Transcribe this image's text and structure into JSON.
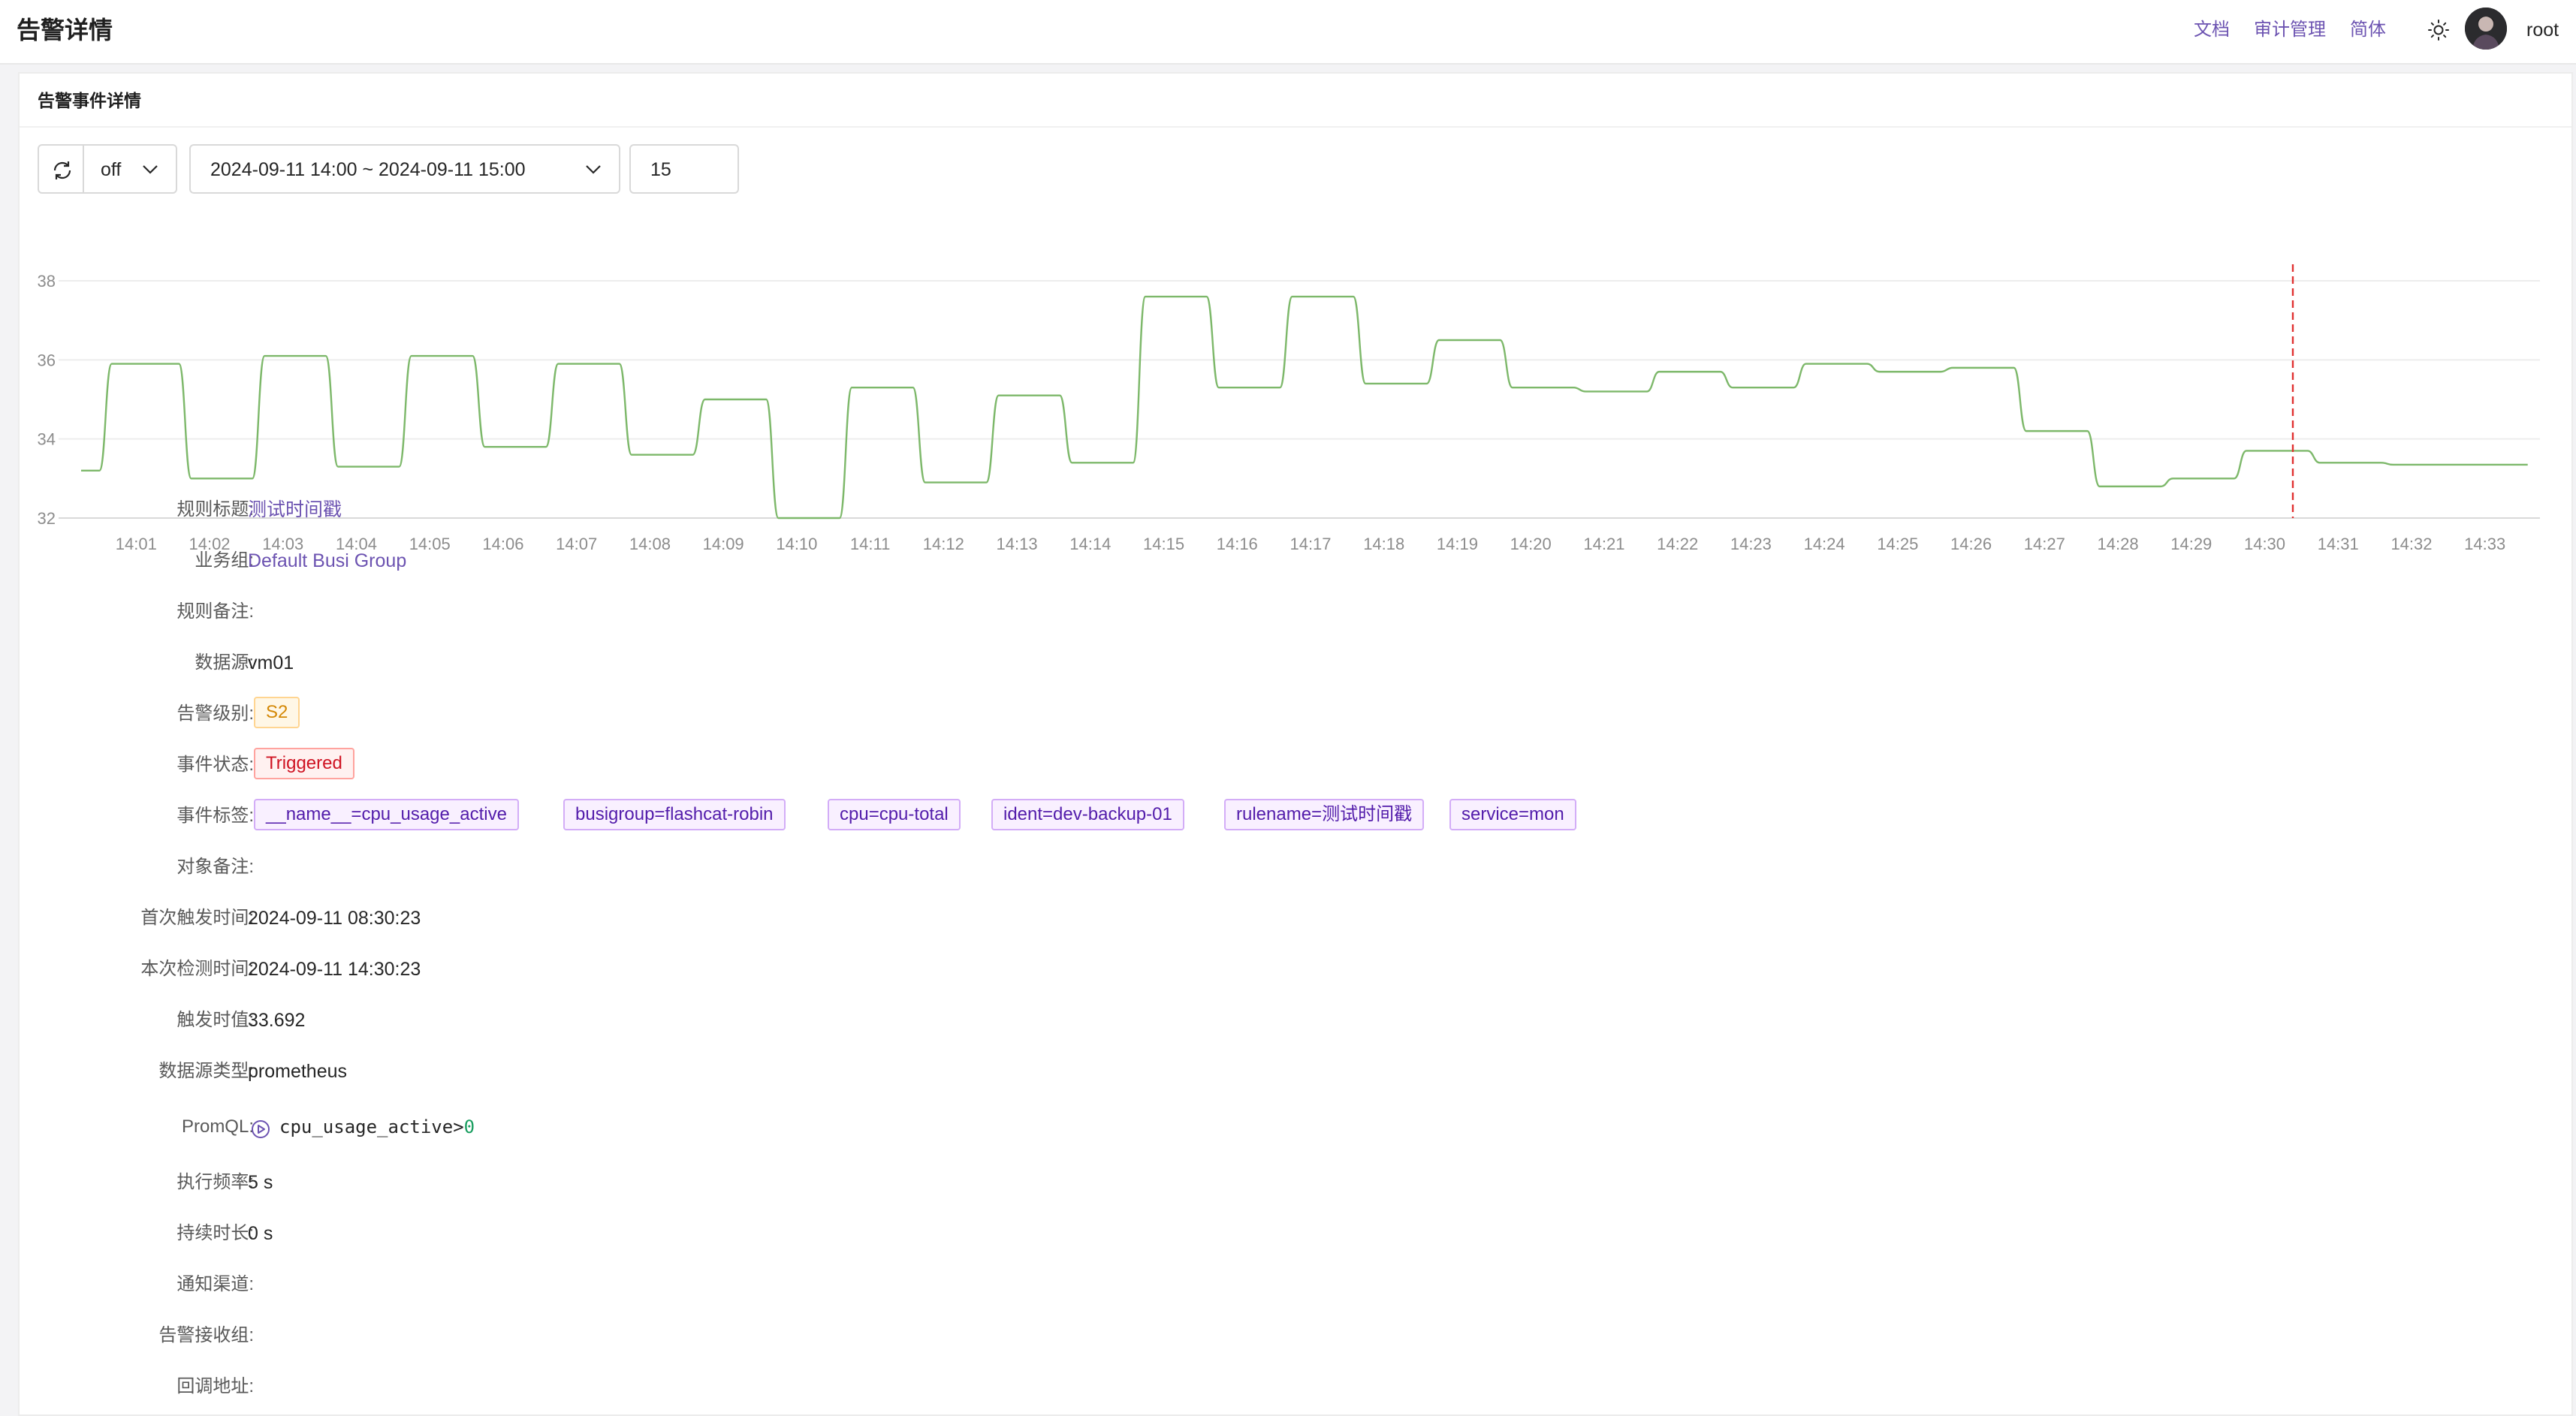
{
  "header": {
    "title": "告警详情",
    "links": [
      "文档",
      "审计管理",
      "简体"
    ],
    "user": "root"
  },
  "card": {
    "title": "告警事件详情",
    "toolbar": {
      "refresh_interval": "off",
      "time_range": "2024-09-11 14:00 ~ 2024-09-11 15:00",
      "step": "15"
    }
  },
  "chart_data": {
    "type": "line",
    "series": [
      {
        "color": "#7db86a",
        "points": [
          [
            "14:00:15",
            33.2
          ],
          [
            "14:00:30",
            33.2
          ],
          [
            "14:00:40",
            35.9
          ],
          [
            "14:01:35",
            35.9
          ],
          [
            "14:01:45",
            33.0
          ],
          [
            "14:02:35",
            33.0
          ],
          [
            "14:02:45",
            36.1
          ],
          [
            "14:03:35",
            36.1
          ],
          [
            "14:03:45",
            33.3
          ],
          [
            "14:04:35",
            33.3
          ],
          [
            "14:04:45",
            36.1
          ],
          [
            "14:05:35",
            36.1
          ],
          [
            "14:05:45",
            33.8
          ],
          [
            "14:06:35",
            33.8
          ],
          [
            "14:06:45",
            35.9
          ],
          [
            "14:07:35",
            35.9
          ],
          [
            "14:07:45",
            33.6
          ],
          [
            "14:08:35",
            33.6
          ],
          [
            "14:08:45",
            35.0
          ],
          [
            "14:09:35",
            35.0
          ],
          [
            "14:09:45",
            32.0
          ],
          [
            "14:10:35",
            32.0
          ],
          [
            "14:10:45",
            35.3
          ],
          [
            "14:11:35",
            35.3
          ],
          [
            "14:11:45",
            32.9
          ],
          [
            "14:12:35",
            32.9
          ],
          [
            "14:12:45",
            35.1
          ],
          [
            "14:13:35",
            35.1
          ],
          [
            "14:13:45",
            33.4
          ],
          [
            "14:14:35",
            33.4
          ],
          [
            "14:14:45",
            37.6
          ],
          [
            "14:15:35",
            37.6
          ],
          [
            "14:15:45",
            35.3
          ],
          [
            "14:16:35",
            35.3
          ],
          [
            "14:16:45",
            37.6
          ],
          [
            "14:17:35",
            37.6
          ],
          [
            "14:17:45",
            35.4
          ],
          [
            "14:18:35",
            35.4
          ],
          [
            "14:18:45",
            36.5
          ],
          [
            "14:19:35",
            36.5
          ],
          [
            "14:19:45",
            35.3
          ],
          [
            "14:20:35",
            35.3
          ],
          [
            "14:20:45",
            35.2
          ],
          [
            "14:21:35",
            35.2
          ],
          [
            "14:21:45",
            35.7
          ],
          [
            "14:22:35",
            35.7
          ],
          [
            "14:22:45",
            35.3
          ],
          [
            "14:23:35",
            35.3
          ],
          [
            "14:23:45",
            35.9
          ],
          [
            "14:24:35",
            35.9
          ],
          [
            "14:24:45",
            35.7
          ],
          [
            "14:25:35",
            35.7
          ],
          [
            "14:25:45",
            35.8
          ],
          [
            "14:26:35",
            35.8
          ],
          [
            "14:26:45",
            34.2
          ],
          [
            "14:27:35",
            34.2
          ],
          [
            "14:27:45",
            32.8
          ],
          [
            "14:28:35",
            32.8
          ],
          [
            "14:28:45",
            33.0
          ],
          [
            "14:29:35",
            33.0
          ],
          [
            "14:29:45",
            33.7
          ],
          [
            "14:30:35",
            33.7
          ],
          [
            "14:30:45",
            33.4
          ],
          [
            "14:31:35",
            33.4
          ],
          [
            "14:31:45",
            33.35
          ],
          [
            "14:33:35",
            33.35
          ]
        ]
      }
    ],
    "trigger_marker": {
      "x": "14:30:23",
      "color": "#e03131"
    },
    "x_ticks": [
      "14:01",
      "14:02",
      "14:03",
      "14:04",
      "14:05",
      "14:06",
      "14:07",
      "14:08",
      "14:09",
      "14:10",
      "14:11",
      "14:12",
      "14:13",
      "14:14",
      "14:15",
      "14:16",
      "14:17",
      "14:18",
      "14:19",
      "14:20",
      "14:21",
      "14:22",
      "14:23",
      "14:24",
      "14:25",
      "14:26",
      "14:27",
      "14:28",
      "14:29",
      "14:30",
      "14:31",
      "14:32",
      "14:33"
    ],
    "y_ticks": [
      32,
      34,
      36,
      38
    ],
    "ylim": [
      32,
      38
    ],
    "grid": true
  },
  "details": {
    "rule_title": {
      "label": "规则标题:",
      "value": "测试时间戳"
    },
    "busi_group": {
      "label": "业务组:",
      "value": "Default Busi Group"
    },
    "rule_note": {
      "label": "规则备注:",
      "value": ""
    },
    "datasource": {
      "label": "数据源:",
      "value": "vm01"
    },
    "severity": {
      "label": "告警级别:",
      "value": "S2"
    },
    "status": {
      "label": "事件状态:",
      "value": "Triggered"
    },
    "tags": {
      "label": "事件标签:",
      "values": [
        "__name__=cpu_usage_active",
        "busigroup=flashcat-robin",
        "cpu=cpu-total",
        "ident=dev-backup-01",
        "rulename=测试时间戳",
        "service=mon"
      ]
    },
    "target_note": {
      "label": "对象备注:",
      "value": ""
    },
    "first_trigger_time": {
      "label": "首次触发时间:",
      "value": "2024-09-11 08:30:23"
    },
    "last_eval_time": {
      "label": "本次检测时间:",
      "value": "2024-09-11 14:30:23"
    },
    "trigger_value": {
      "label": "触发时值:",
      "value": "33.692"
    },
    "datasource_type": {
      "label": "数据源类型:",
      "value": "prometheus"
    },
    "promql": {
      "label": "PromQL:",
      "expr": "cpu_usage_active>",
      "threshold": "0"
    },
    "eval_interval": {
      "label": "执行频率:",
      "value": "5 s"
    },
    "duration": {
      "label": "持续时长:",
      "value": "0 s"
    },
    "notify_channels": {
      "label": "通知渠道:",
      "value": ""
    },
    "notify_groups": {
      "label": "告警接收组:",
      "value": ""
    },
    "callbacks": {
      "label": "回调地址:",
      "value": ""
    }
  }
}
